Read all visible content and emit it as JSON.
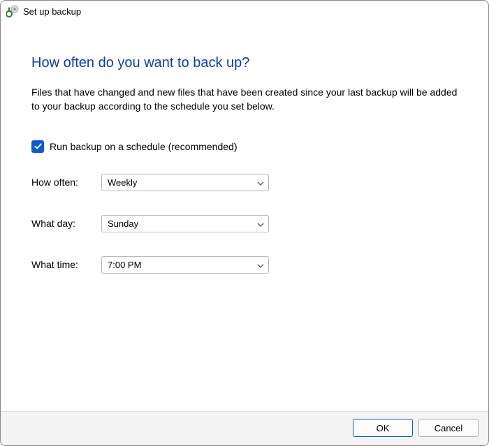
{
  "titlebar": {
    "title": "Set up backup"
  },
  "content": {
    "heading": "How often do you want to back up?",
    "description": "Files that have changed and new files that have been created since your last backup will be added to your backup according to the schedule you set below.",
    "schedule_checkbox_label": "Run backup on a schedule (recommended)",
    "schedule_checked": true,
    "fields": {
      "how_often": {
        "label": "How often:",
        "value": "Weekly"
      },
      "what_day": {
        "label": "What day:",
        "value": "Sunday"
      },
      "what_time": {
        "label": "What time:",
        "value": "7:00 PM"
      }
    }
  },
  "footer": {
    "ok_label": "OK",
    "cancel_label": "Cancel"
  }
}
